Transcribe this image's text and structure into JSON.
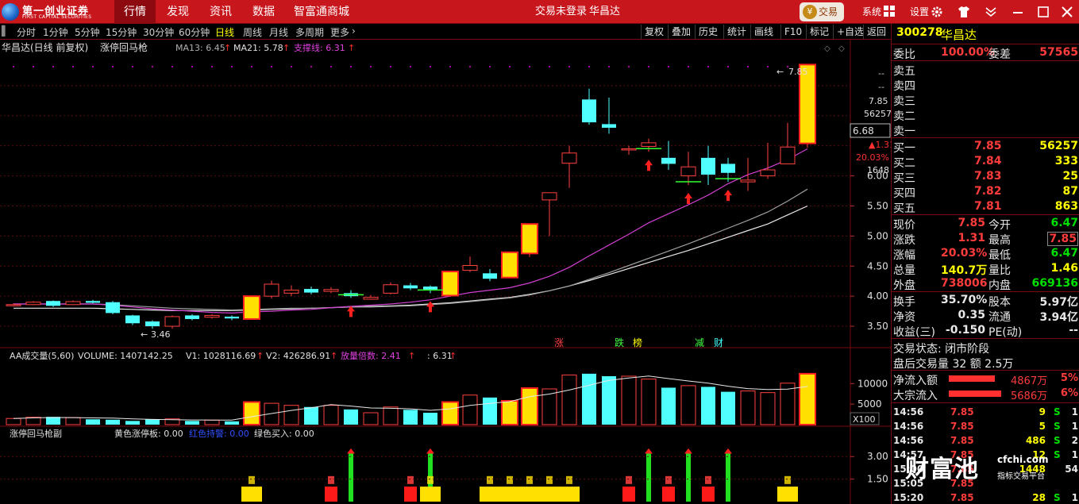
{
  "brand": {
    "name": "第一创业证券",
    "name_en": "FIRST CAPITAL SECURITIES"
  },
  "nav": [
    "行情",
    "发现",
    "资讯",
    "数据",
    "智富通商城"
  ],
  "top_center": {
    "status": "交易未登录",
    "stock": "华昌达"
  },
  "trade_button": {
    "icon": "¥",
    "label": "交易"
  },
  "top_right": {
    "system": "系统",
    "settings": "设置"
  },
  "periods": [
    "分时",
    "1分钟",
    "5分钟",
    "15分钟",
    "30分钟",
    "60分钟",
    "日线",
    "周线",
    "月线",
    "多周期",
    "更多"
  ],
  "active_period": "日线",
  "right_tools": [
    "复权",
    "叠加",
    "历史",
    "统计",
    "画线",
    "F10",
    "标记",
    "+自选",
    "返回"
  ],
  "main_legend": {
    "title": "华昌达(日线 前复权)",
    "indicator": "涨停回马枪",
    "ma13": "MA13: 6.45",
    "ma21": "MA21: 5.78",
    "support": "支撑线: 6.31"
  },
  "price_axis": {
    "labels": [
      "6.00",
      "5.50",
      "5.00",
      "4.50",
      "4.00",
      "3.50"
    ],
    "top_dashes": [
      "--",
      "--"
    ],
    "px": "7.85",
    "vol": "56257",
    "cur": "6.68",
    "chg": "▲1.31",
    "pct": "20.03%",
    "mini": "1648"
  },
  "annotations": {
    "high": "7.85",
    "low": "3.46"
  },
  "markers": [
    "涨",
    "跌",
    "榜",
    "减",
    "财"
  ],
  "vol_legend": {
    "name": "AA成交量(5,60)",
    "volume": "VOLUME: 1407142.25",
    "v1": "V1: 1028116.69",
    "v2": "V2: 426286.91",
    "ratio": "放量倍数: 2.41",
    "extra": ": 6.31"
  },
  "vol_axis": {
    "labels": [
      "10000",
      "5000"
    ],
    "unit": "X100"
  },
  "sub_legend": {
    "name": "涨停回马枪副",
    "yellow": "黄色涨停板: 0.00",
    "red": "红色持警: 0.00",
    "green": "绿色买入: 0.00"
  },
  "sub_axis": {
    "labels": [
      "3.00",
      "1.50"
    ]
  },
  "quote": {
    "code": "300278",
    "name": "华昌达",
    "weibi": {
      "label": "委比",
      "value": "100.00%",
      "label2": "委差",
      "value2": "57565"
    },
    "asks": [
      {
        "label": "卖五"
      },
      {
        "label": "卖四"
      },
      {
        "label": "卖三"
      },
      {
        "label": "卖二"
      },
      {
        "label": "卖一"
      }
    ],
    "bids": [
      {
        "label": "买一",
        "price": "7.85",
        "vol": "56257"
      },
      {
        "label": "买二",
        "price": "7.84",
        "vol": "333"
      },
      {
        "label": "买三",
        "price": "7.83",
        "vol": "25"
      },
      {
        "label": "买四",
        "price": "7.82",
        "vol": "87"
      },
      {
        "label": "买五",
        "price": "7.81",
        "vol": "863"
      }
    ],
    "stats": [
      {
        "l1": "现价",
        "v1": "7.85",
        "c1": "red",
        "l2": "今开",
        "v2": "6.47",
        "c2": "grn"
      },
      {
        "l1": "涨跌",
        "v1": "1.31",
        "c1": "red",
        "l2": "最高",
        "v2": "7.85",
        "c2": "red"
      },
      {
        "l1": "涨幅",
        "v1": "20.03%",
        "c1": "red",
        "l2": "最低",
        "v2": "6.47",
        "c2": "grn"
      },
      {
        "l1": "总量",
        "v1": "140.7万",
        "c1": "yel",
        "l2": "量比",
        "v2": "1.46",
        "c2": "yel"
      },
      {
        "l1": "外盘",
        "v1": "738006",
        "c1": "red",
        "l2": "内盘",
        "v2": "669136",
        "c2": "grn"
      }
    ],
    "stats2": [
      {
        "l1": "换手",
        "v1": "35.70%",
        "l2": "股本",
        "v2": "5.97亿"
      },
      {
        "l1": "净资",
        "v1": "0.35",
        "l2": "流通",
        "v2": "3.94亿"
      },
      {
        "l1": "收益(三)",
        "v1": "-0.150",
        "l2": "PE(动)",
        "v2": "--"
      }
    ],
    "status": "交易状态: 闭市阶段",
    "after": "盘后交易量 32 额 2.5万",
    "flows": [
      {
        "label": "净流入额",
        "value": "4867万",
        "pct": "5%"
      },
      {
        "label": "大宗流入",
        "value": "5686万",
        "pct": "6%"
      }
    ],
    "ticks": [
      {
        "time": "14:56",
        "price": "7.85",
        "vol": "9",
        "bs": "S",
        "n": "1"
      },
      {
        "time": "14:56",
        "price": "7.85",
        "vol": "5",
        "bs": "S",
        "n": "1"
      },
      {
        "time": "14:56",
        "price": "7.85",
        "vol": "486",
        "bs": "S",
        "n": "2"
      },
      {
        "time": "14:57",
        "price": "7.85",
        "vol": "12",
        "bs": "S",
        "n": "1"
      },
      {
        "time": "15:00",
        "price": "7.85",
        "vol": "1448",
        "bs": "",
        "n": "54"
      },
      {
        "time": "15:05",
        "price": "7.85",
        "vol": "",
        "bs": "",
        "n": ""
      },
      {
        "time": "15:20",
        "price": "7.85",
        "vol": "28",
        "bs": "S",
        "n": "1"
      }
    ]
  },
  "watermark": {
    "name": "财富池",
    "site": "cfchi.com",
    "slogan": "指标交易平台"
  },
  "chart_data": {
    "type": "candlestick",
    "candles": [
      [
        3.85,
        3.86,
        3.88,
        3.83
      ],
      [
        3.86,
        3.9,
        3.92,
        3.85
      ],
      [
        3.92,
        3.84,
        3.93,
        3.82
      ],
      [
        3.86,
        3.91,
        3.93,
        3.85
      ],
      [
        3.92,
        3.89,
        3.94,
        3.88
      ],
      [
        3.9,
        3.72,
        3.92,
        3.7
      ],
      [
        3.68,
        3.55,
        3.69,
        3.52
      ],
      [
        3.58,
        3.5,
        3.6,
        3.46
      ],
      [
        3.5,
        3.66,
        3.68,
        3.46
      ],
      [
        3.68,
        3.62,
        3.7,
        3.6
      ],
      [
        3.65,
        3.68,
        3.7,
        3.63
      ],
      [
        3.66,
        3.63,
        3.68,
        3.6
      ],
      [
        3.62,
        4.0,
        4.0,
        3.61
      ],
      [
        4.0,
        4.2,
        4.26,
        3.96
      ],
      [
        4.05,
        4.1,
        4.18,
        4.0
      ],
      [
        4.12,
        4.06,
        4.16,
        4.03
      ],
      [
        4.08,
        4.11,
        4.15,
        4.05
      ],
      [
        4.05,
        4.0,
        4.1,
        3.97
      ],
      [
        3.95,
        3.98,
        4.02,
        3.94
      ],
      [
        4.05,
        4.19,
        4.23,
        4.03
      ],
      [
        4.18,
        4.13,
        4.22,
        4.1
      ],
      [
        4.16,
        4.1,
        4.18,
        4.05
      ],
      [
        4.01,
        4.41,
        4.41,
        4.0
      ],
      [
        4.43,
        4.51,
        4.66,
        4.4
      ],
      [
        4.38,
        4.29,
        4.45,
        4.25
      ],
      [
        4.31,
        4.73,
        4.73,
        4.3
      ],
      [
        4.71,
        5.2,
        5.2,
        4.65
      ],
      [
        5.6,
        5.72,
        5.72,
        5.0
      ],
      [
        6.21,
        6.38,
        6.5,
        5.8
      ],
      [
        7.27,
        6.89,
        7.45,
        6.85
      ],
      [
        6.86,
        6.8,
        7.3,
        6.7
      ],
      [
        6.45,
        6.45,
        6.5,
        6.35
      ],
      [
        6.49,
        6.55,
        6.62,
        6.4
      ],
      [
        6.3,
        6.2,
        6.58,
        6.1
      ],
      [
        6.0,
        6.15,
        6.4,
        5.85
      ],
      [
        6.3,
        6.02,
        6.5,
        5.85
      ],
      [
        6.2,
        6.05,
        6.3,
        5.9
      ],
      [
        5.9,
        5.93,
        6.3,
        5.75
      ],
      [
        6.0,
        6.1,
        6.55,
        5.95
      ],
      [
        6.2,
        6.48,
        6.88,
        6.4
      ],
      [
        6.54,
        7.85,
        7.85,
        6.47
      ]
    ],
    "volumes": [
      1500,
      1800,
      1900,
      1700,
      1300,
      1200,
      900,
      1300,
      1400,
      900,
      1100,
      800,
      5500,
      5200,
      4700,
      4300,
      4700,
      3700,
      2900,
      4300,
      3600,
      2900,
      5500,
      7200,
      6600,
      5800,
      8900,
      8700,
      12100,
      12400,
      11800,
      11800,
      11100,
      9000,
      9500,
      9200,
      8000,
      8200,
      7800,
      10100,
      12400
    ],
    "ma13": [
      3.87,
      3.87,
      3.87,
      3.87,
      3.87,
      3.85,
      3.82,
      3.79,
      3.77,
      3.75,
      3.73,
      3.72,
      3.74,
      3.75,
      3.77,
      3.78,
      3.81,
      3.83,
      3.85,
      3.87,
      3.9,
      3.94,
      4.0,
      4.06,
      4.1,
      4.14,
      4.22,
      4.33,
      4.48,
      4.67,
      4.85,
      5.03,
      5.22,
      5.37,
      5.52,
      5.68,
      5.87,
      6.02,
      6.13,
      6.27,
      6.45
    ],
    "ma21": [
      3.87,
      3.87,
      3.87,
      3.87,
      3.87,
      3.86,
      3.84,
      3.82,
      3.8,
      3.79,
      3.78,
      3.77,
      3.78,
      3.79,
      3.8,
      3.8,
      3.81,
      3.82,
      3.82,
      3.83,
      3.84,
      3.86,
      3.88,
      3.91,
      3.94,
      3.97,
      4.02,
      4.09,
      4.17,
      4.28,
      4.39,
      4.51,
      4.63,
      4.75,
      4.87,
      5.0,
      5.13,
      5.26,
      5.4,
      5.58,
      5.78
    ],
    "support": [
      3.8,
      3.8,
      3.8,
      3.8,
      3.8,
      3.79,
      3.78,
      3.77,
      3.76,
      3.76,
      3.76,
      3.76,
      3.77,
      3.78,
      3.79,
      3.8,
      3.81,
      3.82,
      3.83,
      3.84,
      3.85,
      3.87,
      3.89,
      3.92,
      3.95,
      3.98,
      4.03,
      4.09,
      4.17,
      4.26,
      4.36,
      4.46,
      4.56,
      4.66,
      4.76,
      4.87,
      4.98,
      5.09,
      5.2,
      5.35,
      5.5
    ],
    "ylim": [
      3.25,
      8.0
    ],
    "vol_ylim": [
      0,
      14500
    ],
    "buy_arrows": [
      17,
      21,
      32,
      34,
      36
    ],
    "sub_signals": [
      {
        "i": 12,
        "type": "yellow"
      },
      {
        "i": 16,
        "type": "red"
      },
      {
        "i": 17,
        "type": "green"
      },
      {
        "i": 20,
        "type": "red"
      },
      {
        "i": 21,
        "type": "green"
      },
      {
        "i": 21,
        "type": "yellow"
      },
      {
        "i": 24,
        "type": "yellow"
      },
      {
        "i": 25,
        "type": "yellow"
      },
      {
        "i": 26,
        "type": "yellow"
      },
      {
        "i": 27,
        "type": "yellow"
      },
      {
        "i": 28,
        "type": "yellow"
      },
      {
        "i": 31,
        "type": "red"
      },
      {
        "i": 32,
        "type": "green"
      },
      {
        "i": 33,
        "type": "red"
      },
      {
        "i": 34,
        "type": "green"
      },
      {
        "i": 35,
        "type": "red"
      },
      {
        "i": 36,
        "type": "green"
      },
      {
        "i": 39,
        "type": "yellow"
      }
    ]
  }
}
